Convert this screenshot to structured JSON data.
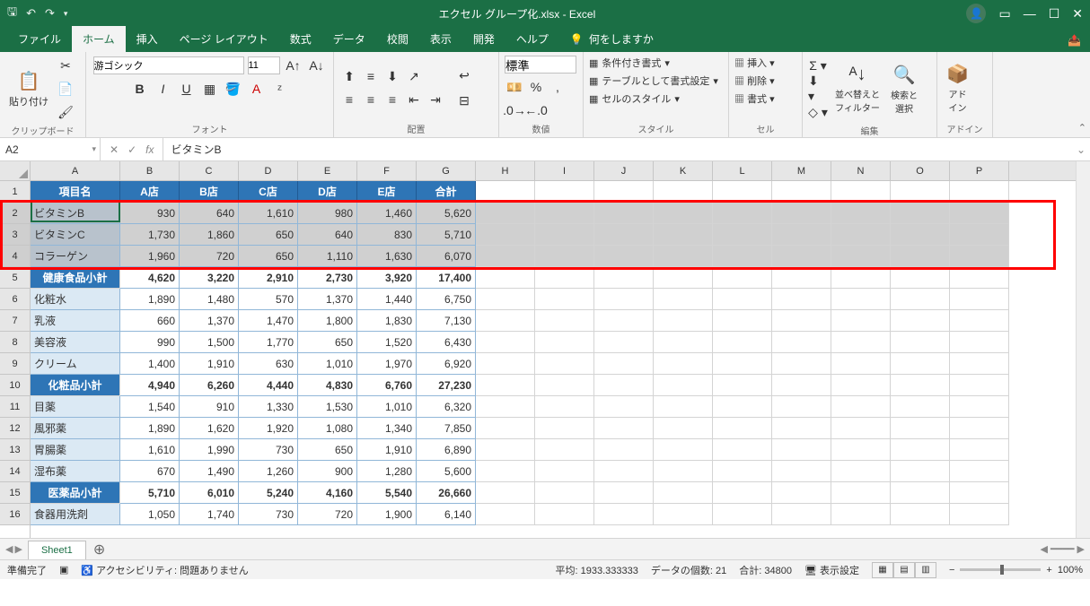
{
  "title": "エクセル グループ化.xlsx  -  Excel",
  "tabs": {
    "file": "ファイル",
    "home": "ホーム",
    "insert": "挿入",
    "layout": "ページ レイアウト",
    "formula": "数式",
    "data": "データ",
    "review": "校閲",
    "view": "表示",
    "dev": "開発",
    "help": "ヘルプ",
    "tell": "何をしますか"
  },
  "ribbon": {
    "clipboard": {
      "paste": "貼り付け",
      "label": "クリップボード"
    },
    "font": {
      "name": "游ゴシック",
      "size": "11",
      "label": "フォント"
    },
    "align": {
      "wrap": "折り返して全体を表示する",
      "merge": "セルを結合して中央揃え",
      "label": "配置"
    },
    "number": {
      "fmt": "標準",
      "label": "数値"
    },
    "styles": {
      "cond": "条件付き書式",
      "tbl": "テーブルとして書式設定",
      "cell": "セルのスタイル",
      "label": "スタイル"
    },
    "cells": {
      "ins": "挿入",
      "del": "削除",
      "fmt": "書式",
      "label": "セル"
    },
    "edit": {
      "sort": "並べ替えと\nフィルター",
      "find": "検索と\n選択",
      "label": "編集"
    },
    "addin": {
      "btn": "アド\nイン",
      "label": "アドイン"
    }
  },
  "namebox": "A2",
  "formula": "ビタミンB",
  "cols": [
    "A",
    "B",
    "C",
    "D",
    "E",
    "F",
    "G",
    "H",
    "I",
    "J",
    "K",
    "L",
    "M",
    "N",
    "O",
    "P"
  ],
  "headers": [
    "項目名",
    "A店",
    "B店",
    "C店",
    "D店",
    "E店",
    "合計"
  ],
  "rows": [
    {
      "n": 1,
      "type": "header"
    },
    {
      "n": 2,
      "type": "data",
      "sel": true,
      "cells": [
        "ビタミンB",
        "930",
        "640",
        "1,610",
        "980",
        "1,460",
        "5,620"
      ]
    },
    {
      "n": 3,
      "type": "data",
      "sel": true,
      "cells": [
        "ビタミンC",
        "1,730",
        "1,860",
        "650",
        "640",
        "830",
        "5,710"
      ]
    },
    {
      "n": 4,
      "type": "data",
      "sel": true,
      "cells": [
        "コラーゲン",
        "1,960",
        "720",
        "650",
        "1,110",
        "1,630",
        "6,070"
      ]
    },
    {
      "n": 5,
      "type": "sub",
      "cells": [
        "健康食品小計",
        "4,620",
        "3,220",
        "2,910",
        "2,730",
        "3,920",
        "17,400"
      ]
    },
    {
      "n": 6,
      "type": "data",
      "cells": [
        "化粧水",
        "1,890",
        "1,480",
        "570",
        "1,370",
        "1,440",
        "6,750"
      ]
    },
    {
      "n": 7,
      "type": "data",
      "cells": [
        "乳液",
        "660",
        "1,370",
        "1,470",
        "1,800",
        "1,830",
        "7,130"
      ]
    },
    {
      "n": 8,
      "type": "data",
      "cells": [
        "美容液",
        "990",
        "1,500",
        "1,770",
        "650",
        "1,520",
        "6,430"
      ]
    },
    {
      "n": 9,
      "type": "data",
      "cells": [
        "クリーム",
        "1,400",
        "1,910",
        "630",
        "1,010",
        "1,970",
        "6,920"
      ]
    },
    {
      "n": 10,
      "type": "sub",
      "cells": [
        "化粧品小計",
        "4,940",
        "6,260",
        "4,440",
        "4,830",
        "6,760",
        "27,230"
      ]
    },
    {
      "n": 11,
      "type": "data",
      "cells": [
        "目薬",
        "1,540",
        "910",
        "1,330",
        "1,530",
        "1,010",
        "6,320"
      ]
    },
    {
      "n": 12,
      "type": "data",
      "cells": [
        "風邪薬",
        "1,890",
        "1,620",
        "1,920",
        "1,080",
        "1,340",
        "7,850"
      ]
    },
    {
      "n": 13,
      "type": "data",
      "cells": [
        "胃腸薬",
        "1,610",
        "1,990",
        "730",
        "650",
        "1,910",
        "6,890"
      ]
    },
    {
      "n": 14,
      "type": "data",
      "cells": [
        "湿布薬",
        "670",
        "1,490",
        "1,260",
        "900",
        "1,280",
        "5,600"
      ]
    },
    {
      "n": 15,
      "type": "sub",
      "cells": [
        "医薬品小計",
        "5,710",
        "6,010",
        "5,240",
        "4,160",
        "5,540",
        "26,660"
      ]
    },
    {
      "n": 16,
      "type": "data",
      "cells": [
        "食器用洗剤",
        "1,050",
        "1,740",
        "730",
        "720",
        "1,900",
        "6,140"
      ]
    }
  ],
  "sheet": "Sheet1",
  "status": {
    "ready": "準備完了",
    "acc": "アクセシビリティ: 問題ありません",
    "avg": "平均: 1933.333333",
    "count": "データの個数: 21",
    "sum": "合計: 34800",
    "disp": "表示設定",
    "zoom": "100%"
  }
}
